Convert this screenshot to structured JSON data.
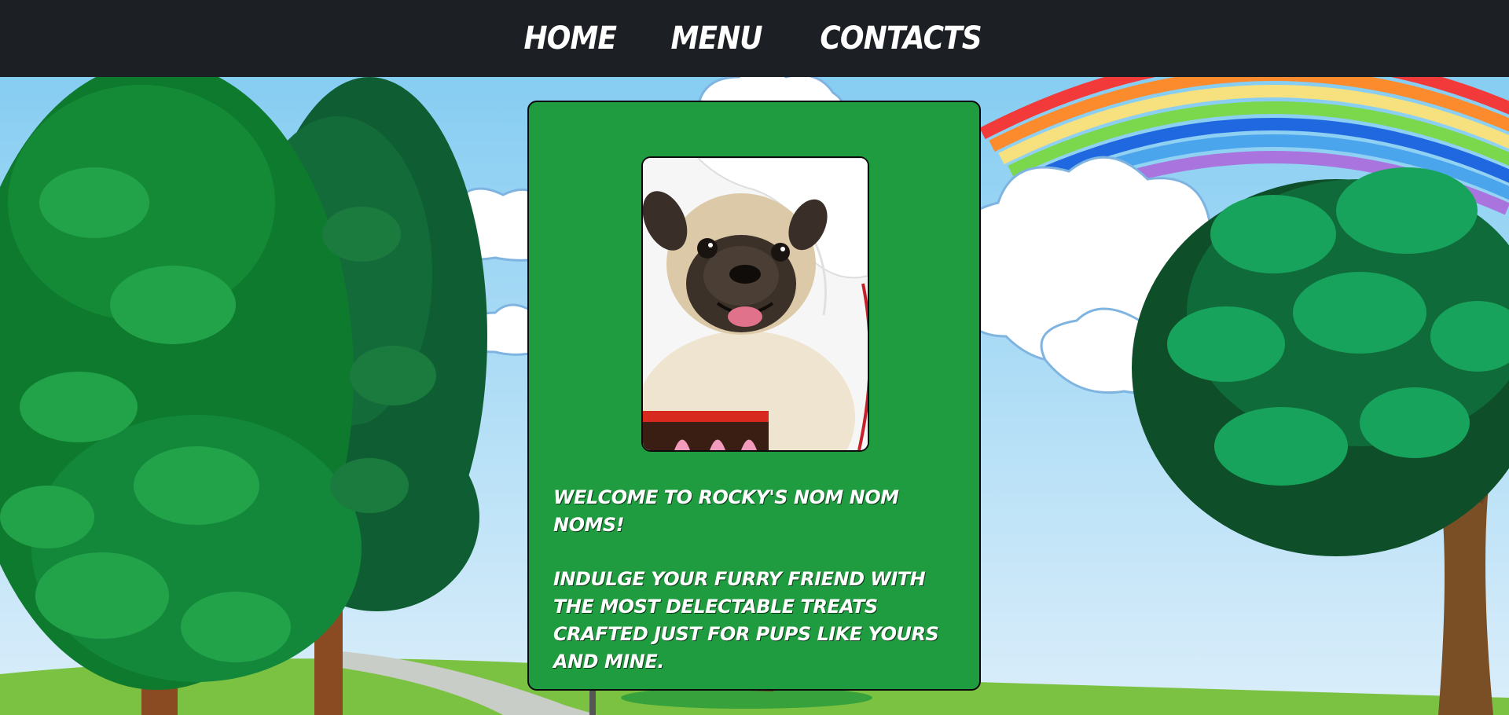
{
  "nav": {
    "items": [
      {
        "label": "HOME"
      },
      {
        "label": "MENU"
      },
      {
        "label": "CONTACTS"
      }
    ]
  },
  "card": {
    "welcome": "WELCOME TO ROCKY'S NOM NOM NOMS!",
    "description": "INDULGE YOUR FURRY FRIEND WITH THE MOST DELECTABLE TREATS CRAFTED JUST FOR PUPS LIKE YOURS AND MINE."
  },
  "colors": {
    "nav_background": "#1c1f23",
    "card_background": "#1f9c3f",
    "sky": "#9fd4f2",
    "text": "#ffffff"
  }
}
